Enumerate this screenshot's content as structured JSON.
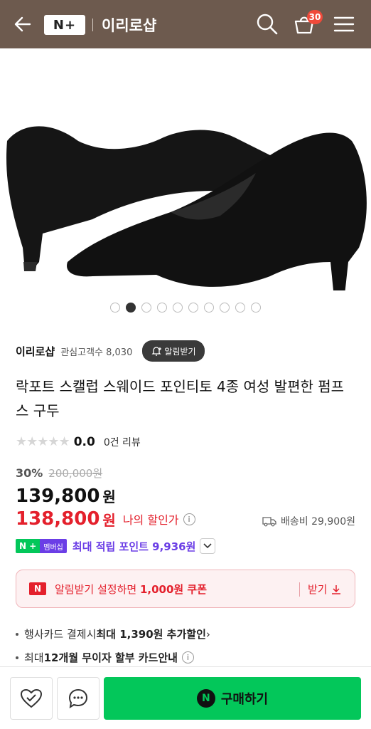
{
  "header": {
    "logo_text": "N+",
    "shop_title": "이리로샵",
    "cart_count": "30",
    "bg_color": "#6d5a4e"
  },
  "gallery": {
    "image_alt": "black suede pointed-toe pumps",
    "dot_count": 10,
    "active_index": 1
  },
  "store": {
    "name": "이리로샵",
    "fans_label": "관심고객수 8,030",
    "alarm_label": "알림받기"
  },
  "product": {
    "title": "락포트 스캘럽 스웨이드 포인티토 4종 여성 발편한 펌프스 구두",
    "stars": "★★★★★",
    "rating": "0.0",
    "review_label": "0건 리뷰",
    "discount_pct": "30%",
    "original_price": "200,000원",
    "price": "139,800",
    "price_unit": "원",
    "my_price": "138,800",
    "my_price_unit": "원",
    "my_price_label": "나의 할인가",
    "shipping": "배송비 29,900원"
  },
  "membership": {
    "badge_n": "N +",
    "badge_text": "멤버십",
    "points": "최대 적립 포인트 9,936원"
  },
  "coupon": {
    "badge": "N",
    "text_prefix": "알림받기 설정하면 ",
    "text_bold": "1,000원 쿠폰",
    "get_label": "받기"
  },
  "benefits": [
    {
      "prefix": "행사카드 결제시 ",
      "bold": "최대 1,390원 추가할인",
      "suffix": " ›"
    },
    {
      "prefix": "최대 ",
      "bold": "12개월 무이자 할부 카드안내",
      "suffix": ""
    }
  ],
  "bottom": {
    "buy_label": "구매하기",
    "buy_n": "N"
  },
  "colors": {
    "accent_red": "#e4202c",
    "naver_green": "#03c75a",
    "member_purple": "#6b3ee6"
  }
}
